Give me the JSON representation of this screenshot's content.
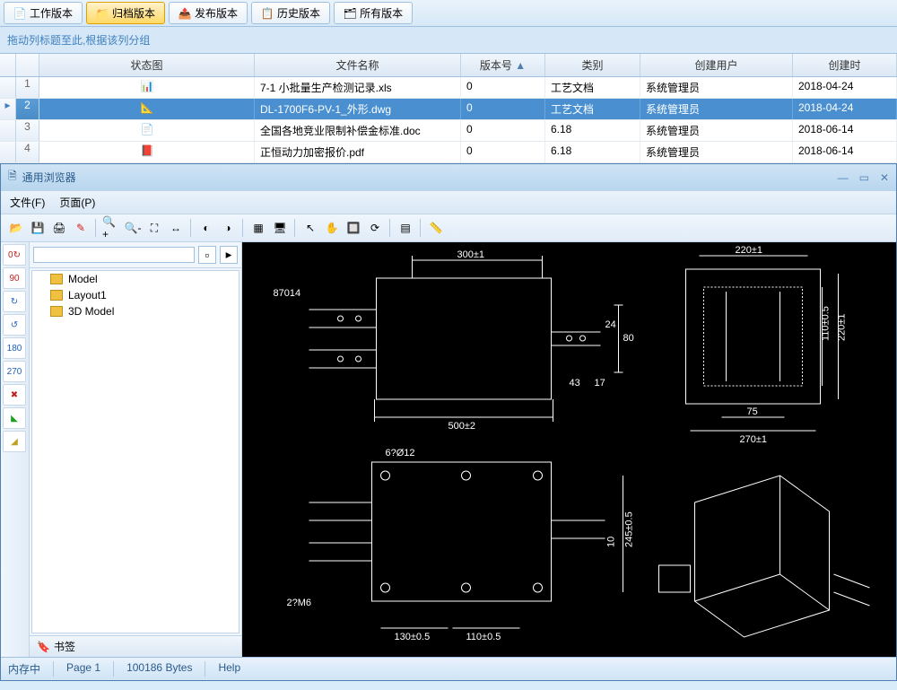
{
  "tabs": [
    {
      "label": "工作版本",
      "icon": "work"
    },
    {
      "label": "归档版本",
      "icon": "archive",
      "active": true
    },
    {
      "label": "发布版本",
      "icon": "publish"
    },
    {
      "label": "历史版本",
      "icon": "history"
    },
    {
      "label": "所有版本",
      "icon": "all"
    }
  ],
  "group_hint": "拖动列标题至此,根据该列分组",
  "columns": {
    "status": "状态图",
    "name": "文件名称",
    "version": "版本号",
    "category": "类别",
    "user": "创建用户",
    "time": "创建时"
  },
  "rows": [
    {
      "n": "1",
      "icon": "xls",
      "name": "7-1 小批量生产检测记录.xls",
      "ver": "0",
      "cat": "工艺文档",
      "user": "系统管理员",
      "time": "2018-04-24"
    },
    {
      "n": "2",
      "icon": "dwg",
      "name": "DL-1700F6-PV-1_外形.dwg",
      "ver": "0",
      "cat": "工艺文档",
      "user": "系统管理员",
      "time": "2018-04-24",
      "selected": true
    },
    {
      "n": "3",
      "icon": "doc",
      "name": "全国各地竞业限制补偿金标准.doc",
      "ver": "0",
      "cat": "6.18",
      "user": "系统管理员",
      "time": "2018-06-14"
    },
    {
      "n": "4",
      "icon": "pdf",
      "name": "正恒动力加密报价.pdf",
      "ver": "0",
      "cat": "6.18",
      "user": "系统管理员",
      "time": "2018-06-14"
    }
  ],
  "viewer": {
    "title": "通用浏览器",
    "menu": {
      "file": "文件(F)",
      "page": "页面(P)"
    },
    "tree": {
      "search_placeholder": "",
      "items": [
        "Model",
        "Layout1",
        "3D Model"
      ],
      "bookmark": "书签"
    },
    "status": {
      "mem": "内存中",
      "page": "Page 1",
      "bytes": "100186 Bytes",
      "help": "Help"
    }
  },
  "cad_labels": {
    "d300": "300±1",
    "d87014": "87014",
    "d80": "80",
    "d24": "24",
    "d43": "43",
    "d17": "17",
    "d500": "500±2",
    "d220": "220±1",
    "d220v": "220±1",
    "d110v": "110±0.5",
    "d75": "75",
    "d270": "270±1",
    "d6012": "6?Ø12",
    "d10": "10",
    "d245": "245±0.5",
    "d27m6": "2?M6",
    "d130": "130±0.5",
    "d110": "110±0.5"
  }
}
